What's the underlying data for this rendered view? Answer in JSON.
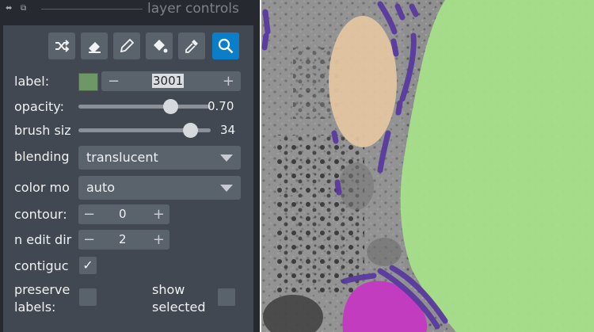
{
  "title_bar": {
    "title": "layer controls",
    "icons": [
      "float-icon",
      "close-icon"
    ]
  },
  "toolbar": {
    "tools": [
      {
        "name": "shuffle-colors-icon",
        "active": false
      },
      {
        "name": "erase-icon",
        "active": false
      },
      {
        "name": "paint-icon",
        "active": false
      },
      {
        "name": "fill-icon",
        "active": false
      },
      {
        "name": "pick-icon",
        "active": false
      },
      {
        "name": "pan-zoom-icon",
        "active": true
      }
    ]
  },
  "controls": {
    "label": {
      "label": "label:",
      "value": "3001",
      "minus": "−",
      "plus": "+",
      "color": "#6d9766"
    },
    "opacity": {
      "label": "opacity:",
      "value": "0.70",
      "fraction": 0.7
    },
    "brush_size": {
      "label": "brush siz",
      "value": "34",
      "fraction": 0.85
    },
    "blending": {
      "label": "blending",
      "value": "translucent"
    },
    "color_mode": {
      "label": "color mo",
      "value": "auto"
    },
    "contour": {
      "label": "contour:",
      "value": "0",
      "minus": "−",
      "plus": "+"
    },
    "n_edit_dim": {
      "label": "n edit dir",
      "value": "2",
      "minus": "−",
      "plus": "+"
    },
    "contiguous": {
      "label": "contiguc",
      "checked": true,
      "mark": "✓"
    },
    "preserve_labels": {
      "label_line1": "preserve",
      "label_line2": "labels:",
      "checked": false
    },
    "show_selected": {
      "label_line1": "show",
      "label_line2": "selected",
      "checked": false
    }
  },
  "colors": {
    "accent": "#0a7ec8",
    "label_green": "#a6e08a",
    "label_tan": "#e8c9a2",
    "label_purple": "#5a3aa0",
    "label_magenta": "#c23cc0"
  }
}
